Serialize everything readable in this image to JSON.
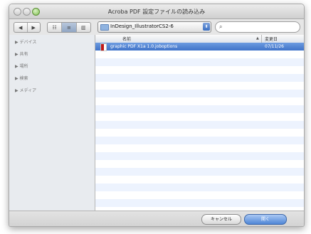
{
  "window": {
    "title": "Acroba PDF 設定ファイルの読み込み"
  },
  "toolbar": {
    "nav_back": "◀",
    "nav_forward": "▶",
    "view_icon": "☷",
    "view_list": "≡",
    "view_column": "▥",
    "location": "InDesign_IllustratorCS2-6",
    "location_arrows": "⬍",
    "search_icon": "search-icon",
    "search_glyph": "⌕"
  },
  "sidebar": {
    "sections": [
      {
        "label": "▶ デバイス"
      },
      {
        "label": "▶ 共有"
      },
      {
        "label": "▶ 場所"
      },
      {
        "label": "▶ 検索"
      },
      {
        "label": "▶ メディア"
      }
    ]
  },
  "filelist": {
    "columns": {
      "name": "名前",
      "date": "変更日",
      "sort_indicator": "▲"
    },
    "rows": [
      {
        "name": "graphic PDF X1a 1.0.joboptions",
        "date": "07/11/26",
        "selected": true
      }
    ]
  },
  "buttons": {
    "cancel": "キャンセル",
    "open": "開く"
  },
  "colors": {
    "selection": "#3f73c9",
    "alt_row": "#edf3fe",
    "default_button": "#4f86d6"
  }
}
